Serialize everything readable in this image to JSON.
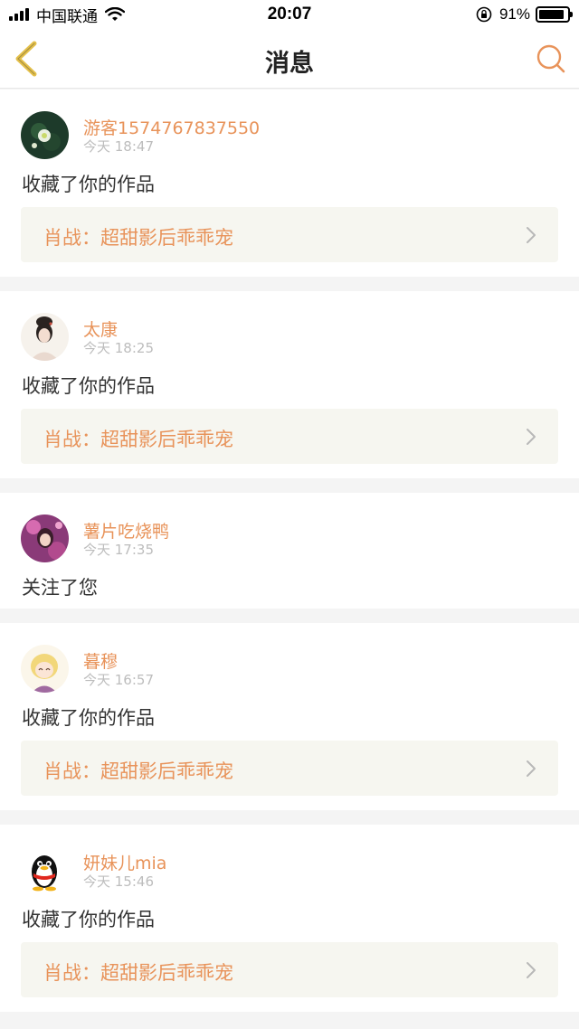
{
  "status": {
    "carrier": "中国联通",
    "time": "20:07",
    "battery": "91%",
    "battery_level": 0.91
  },
  "header": {
    "title": "消息"
  },
  "accent_color": "#e8935a",
  "messages": [
    {
      "user": "游客1574767837550",
      "time": "今天 18:47",
      "action": "收藏了你的作品",
      "work": "肖战：超甜影后乖乖宠",
      "avatar_icon": "flower-avatar"
    },
    {
      "user": "太康",
      "time": "今天 18:25",
      "action": "收藏了你的作品",
      "work": "肖战：超甜影后乖乖宠",
      "avatar_icon": "ancient-lady-avatar"
    },
    {
      "user": "薯片吃烧鸭",
      "time": "今天 17:35",
      "action": "关注了您",
      "work": "",
      "avatar_icon": "anime-girl-avatar"
    },
    {
      "user": "暮穆",
      "time": "今天 16:57",
      "action": "收藏了你的作品",
      "work": "肖战：超甜影后乖乖宠",
      "avatar_icon": "blonde-chibi-avatar"
    },
    {
      "user": "妍妹儿mia",
      "time": "今天 15:46",
      "action": "收藏了你的作品",
      "work": "肖战：超甜影后乖乖宠",
      "avatar_icon": "qq-penguin-avatar"
    }
  ]
}
